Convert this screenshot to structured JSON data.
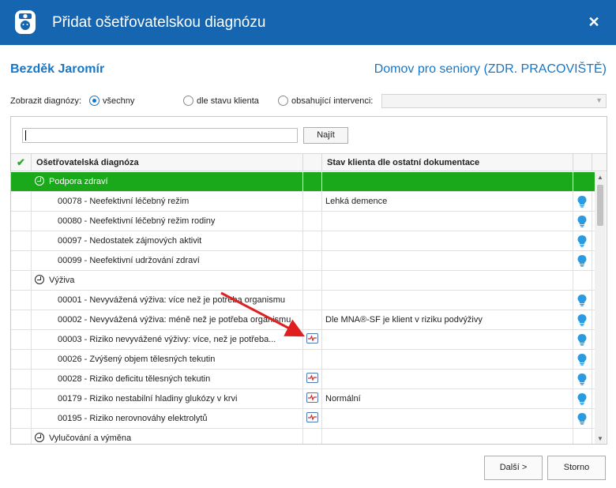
{
  "window": {
    "title": "Přidat ošetřovatelskou diagnózu",
    "close_label": "✕"
  },
  "header": {
    "patient": "Bezděk Jaromír",
    "facility": "Domov pro seniory (ZDR. PRACOVIŠTĚ)"
  },
  "filter": {
    "label": "Zobrazit diagnózy:",
    "options": [
      {
        "label": "všechny",
        "selected": true
      },
      {
        "label": "dle stavu klienta",
        "selected": false
      },
      {
        "label": "obsahující intervenci:",
        "selected": false
      }
    ],
    "combo_value": ""
  },
  "search": {
    "value": "",
    "find_label": "Najít"
  },
  "columns": {
    "diagnosis": "Ošetřovatelská diagnóza",
    "status": "Stav klienta dle ostatní dokumentace"
  },
  "rows": [
    {
      "type": "category",
      "label": "Podpora zdraví",
      "highlight": true
    },
    {
      "type": "item",
      "label": "00078 - Neefektivní léčebný režim",
      "status": "Lehká demence",
      "card": false
    },
    {
      "type": "item",
      "label": "00080 - Neefektivní léčebný režim rodiny",
      "status": "",
      "card": false
    },
    {
      "type": "item",
      "label": "00097 - Nedostatek zájmových aktivit",
      "status": "",
      "card": false
    },
    {
      "type": "item",
      "label": "00099 - Neefektivní udržování zdraví",
      "status": "",
      "card": false
    },
    {
      "type": "category",
      "label": "Výživa",
      "highlight": false
    },
    {
      "type": "item",
      "label": "00001 - Nevyvážená výživa: více než je potřeba organismu",
      "status": "",
      "card": false
    },
    {
      "type": "item",
      "label": "00002 - Nevyvážená výživa: méně než je potřeba organismu",
      "status": "Dle MNA®-SF je klient v riziku podvýživy",
      "card": false
    },
    {
      "type": "item",
      "label": "00003 - Riziko nevyvážené výživy: více, než je potřeba...",
      "status": "",
      "card": true
    },
    {
      "type": "item",
      "label": "00026 - Zvýšený objem tělesných tekutin",
      "status": "",
      "card": false
    },
    {
      "type": "item",
      "label": "00028 - Riziko deficitu tělesných tekutin",
      "status": "",
      "card": true
    },
    {
      "type": "item",
      "label": "00179 - Riziko nestabilní hladiny glukózy v krvi",
      "status": "Normální",
      "card": true
    },
    {
      "type": "item",
      "label": "00195 - Riziko nerovnováhy elektrolytů",
      "status": "",
      "card": true
    },
    {
      "type": "category",
      "label": "Vylučování a výměna",
      "highlight": false
    }
  ],
  "footer": {
    "next_label": "Další >",
    "cancel_label": "Storno"
  },
  "colors": {
    "titlebar": "#1565b0",
    "accent": "#1976c4",
    "category_green": "#19a91a",
    "bulb": "#2a9be0"
  }
}
